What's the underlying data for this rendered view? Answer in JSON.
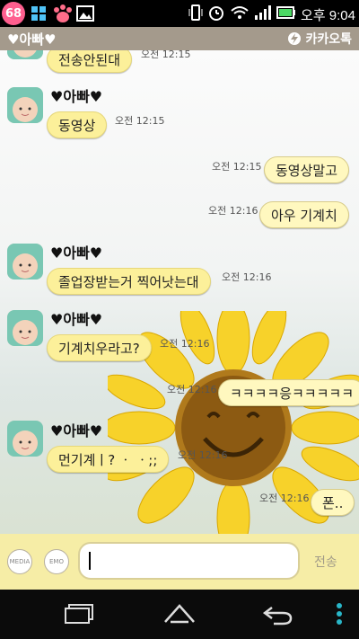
{
  "status_bar": {
    "notification_count": "68",
    "time": "오후 9:04",
    "icons": [
      "notification-badge-icon",
      "grid-icon",
      "paw-icon",
      "image-icon",
      "vibrate-icon",
      "alarm-icon",
      "wifi-icon",
      "signal-icon",
      "battery-icon"
    ]
  },
  "title_bar": {
    "chat_title": "♥아빠♥",
    "app_name": "카카오톡"
  },
  "messages": [
    {
      "type": "in",
      "text": "전송안된대",
      "time": "오전 12:15"
    },
    {
      "type": "in",
      "sender": "♥아빠♥",
      "text": "동영상",
      "time": "오전 12:15"
    },
    {
      "type": "out",
      "text": "동영상말고",
      "time": "오전 12:15"
    },
    {
      "type": "out",
      "text": "아우 기계치",
      "time": "오전 12:16"
    },
    {
      "type": "in",
      "sender": "♥아빠♥",
      "text": "졸업장받는거 찍어낫는대",
      "time": "오전 12:16"
    },
    {
      "type": "in",
      "sender": "♥아빠♥",
      "text": "기계치우라고?",
      "time": "오전 12:16"
    },
    {
      "type": "out",
      "text": "ㅋㅋㅋㅋ응ㅋㅋㅋㅋㅋ",
      "time": "오전 12:16"
    },
    {
      "type": "in",
      "sender": "♥아빠♥",
      "text": "먼기계ㅣ? ㆍ ㆍ;;",
      "time": "오전 12:16"
    },
    {
      "type": "out",
      "text": "폰..",
      "time": "오전 12:16"
    }
  ],
  "input_bar": {
    "media_label": "MEDIA",
    "emo_label": "EMO",
    "message_value": "",
    "send_label": "전송"
  },
  "nav_bar": {
    "icons": [
      "recent-apps-icon",
      "home-icon",
      "back-icon",
      "menu-icon"
    ]
  },
  "colors": {
    "title_bar": "#a49a8c",
    "bubble_in": "#fcf09a",
    "bubble_out": "#fff8bf",
    "input_bar": "#f6eda6"
  }
}
